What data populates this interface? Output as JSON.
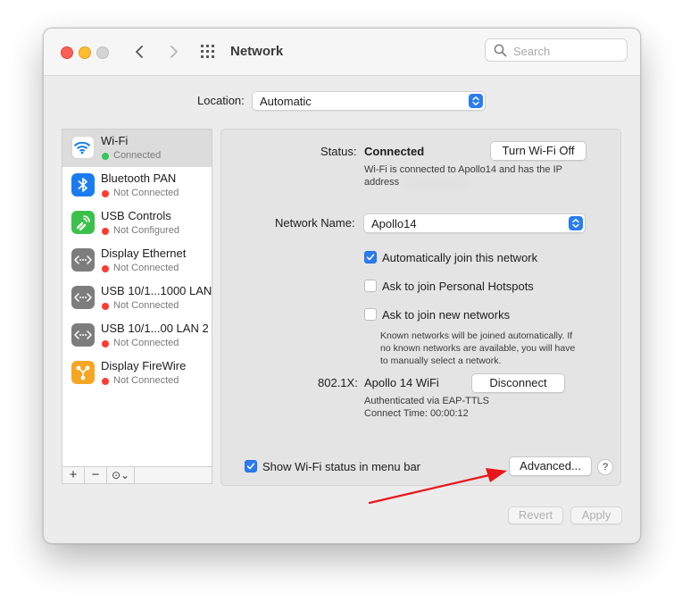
{
  "window": {
    "title": "Network"
  },
  "search": {
    "placeholder": "Search"
  },
  "location": {
    "label": "Location:",
    "value": "Automatic"
  },
  "services": [
    {
      "name": "Wi-Fi",
      "status": "Connected",
      "status_color": "#34c759",
      "icon": "wifi-icon",
      "icon_color": "#ffffff"
    },
    {
      "name": "Bluetooth PAN",
      "status": "Not Connected",
      "status_color": "#ff3b30",
      "icon": "bluetooth-icon",
      "icon_color": "#1a7cf0"
    },
    {
      "name": "USB Controls",
      "status": "Not Configured",
      "status_color": "#ff3b30",
      "icon": "usb-controls-icon",
      "icon_color": "#3cc04c"
    },
    {
      "name": "Display Ethernet",
      "status": "Not Connected",
      "status_color": "#ff3b30",
      "icon": "ethernet-icon",
      "icon_color": "#7d7d7d"
    },
    {
      "name": "USB 10/1...1000 LAN",
      "status": "Not Connected",
      "status_color": "#ff3b30",
      "icon": "ethernet-icon",
      "icon_color": "#7d7d7d"
    },
    {
      "name": "USB 10/1...00 LAN 2",
      "status": "Not Connected",
      "status_color": "#ff3b30",
      "icon": "ethernet-icon",
      "icon_color": "#7d7d7d"
    },
    {
      "name": "Display FireWire",
      "status": "Not Connected",
      "status_color": "#ff3b30",
      "icon": "firewire-icon",
      "icon_color": "#f5a623"
    }
  ],
  "sidebar_tools": {
    "add": "+",
    "remove": "−",
    "action": "⊙⌄"
  },
  "detail": {
    "status_label": "Status:",
    "status_value": "Connected",
    "turn_off_button": "Turn Wi-Fi Off",
    "status_desc_line1": "Wi-Fi is connected to Apollo14 and has the IP",
    "status_desc_line2": "address",
    "network_name_label": "Network Name:",
    "network_name_value": "Apollo14",
    "auto_join": {
      "label": "Automatically join this network",
      "checked": true
    },
    "ask_hotspots": {
      "label": "Ask to join Personal Hotspots",
      "checked": false
    },
    "ask_new": {
      "label": "Ask to join new networks",
      "checked": false
    },
    "known_note_line1": "Known networks will be joined automatically. If",
    "known_note_line2": "no known networks are available, you will have",
    "known_note_line3": "to manually select a network.",
    "dot1x_label": "802.1X:",
    "dot1x_value": "Apollo 14 WiFi",
    "disconnect_button": "Disconnect",
    "auth_line": "Authenticated via EAP-TTLS",
    "connect_time": "Connect Time: 00:00:12",
    "show_status": {
      "label": "Show Wi-Fi status in menu bar",
      "checked": true
    },
    "advanced_button": "Advanced...",
    "help_button": "?"
  },
  "footer": {
    "revert": "Revert",
    "apply": "Apply"
  },
  "colors": {
    "accent": "#2a7cf0",
    "annotation_arrow": "#e8161b"
  }
}
